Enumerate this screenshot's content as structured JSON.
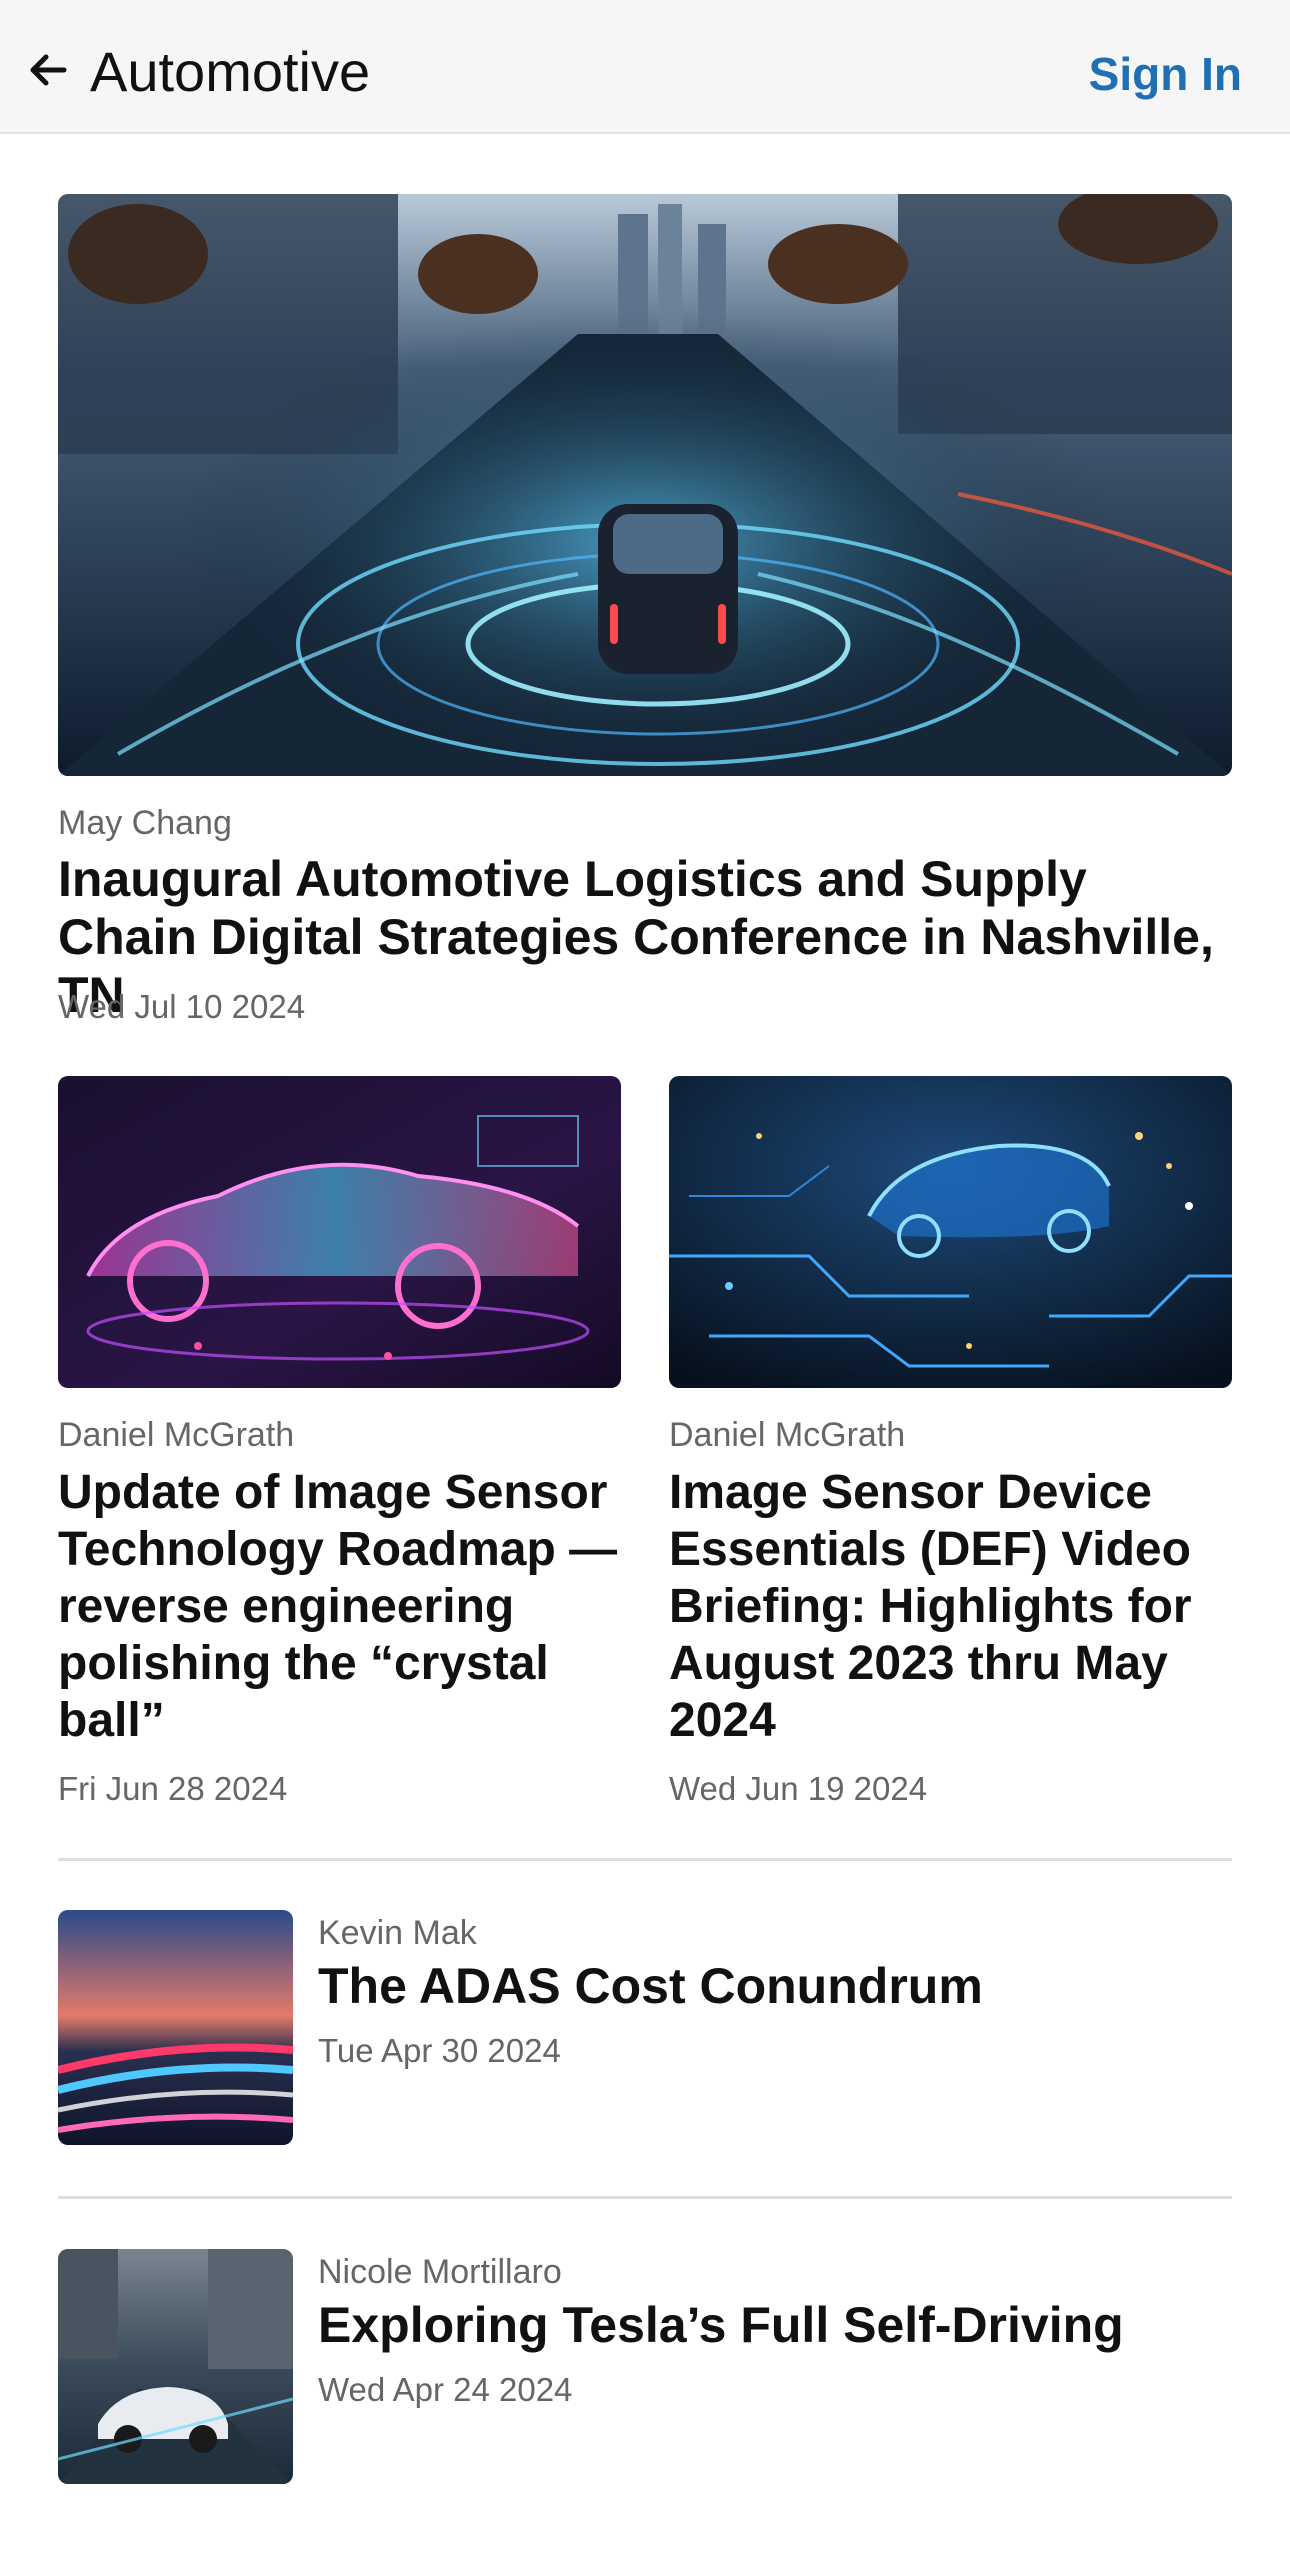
{
  "header": {
    "title": "Automotive",
    "back_icon": "arrow-left-icon",
    "sign_in_label": "Sign In",
    "accent_color": "#1f6fb5"
  },
  "articles": {
    "featured": {
      "author": "May Chang",
      "title": "Inaugural Automotive Logistics and Supply Chain Digital Strategies Conference in Nashville, TN",
      "date": "Wed Jul 10 2024"
    },
    "grid": [
      {
        "author": "Daniel McGrath",
        "title": "Update of Image Sensor Technology Roadmap — reverse engineering polishing the “crystal ball”",
        "date": "Fri Jun 28 2024"
      },
      {
        "author": "Daniel McGrath",
        "title": "Image Sensor Device Essentials (DEF) Video Briefing: Highlights for August 2023 thru May 2024",
        "date": "Wed Jun 19 2024"
      }
    ],
    "list": [
      {
        "author": "Kevin Mak",
        "title": "The ADAS Cost Conundrum",
        "date": "Tue Apr 30 2024"
      },
      {
        "author": "Nicole Mortillaro",
        "title": "Exploring Tesla’s Full Self-Driving",
        "date": "Wed Apr 24 2024"
      }
    ]
  }
}
